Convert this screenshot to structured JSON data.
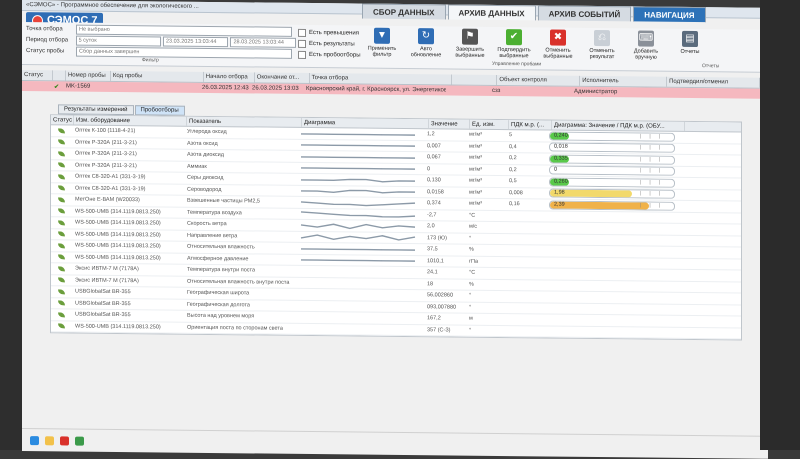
{
  "window": {
    "title": "«СЭМОС» - Программное обеспечение для экологического ..."
  },
  "app": {
    "name": "СЭМОС 7"
  },
  "tabs": [
    {
      "label": "СБОР ДАННЫХ",
      "active": false
    },
    {
      "label": "АРХИВ ДАННЫХ",
      "active": true
    },
    {
      "label": "АРХИВ СОБЫТИЙ",
      "active": false
    },
    {
      "label": "НАВИГАЦИЯ",
      "active": false
    }
  ],
  "filters": {
    "rows": [
      {
        "label": "Точка отбора",
        "value": "Не выбрано"
      },
      {
        "label": "Период отбора",
        "value": "5 суток",
        "from": "23.03.2025 13:03:44",
        "to": "28.03.2025 13:03:44"
      },
      {
        "label": "Статус пробы",
        "value": "Сбор данных завершен"
      }
    ],
    "group_label": "Фильтр"
  },
  "checks": [
    {
      "label": "Есть превышения",
      "checked": false
    },
    {
      "label": "Есть результаты",
      "checked": false
    },
    {
      "label": "Есть пробоотборы",
      "checked": false
    }
  ],
  "ribbon_buttons": [
    {
      "label": "Применить фильтр",
      "icon": "filter-icon",
      "color": "#2f6db5",
      "glyph": "▼"
    },
    {
      "label": "Авто обновление",
      "icon": "refresh-icon",
      "color": "#2f6db5",
      "glyph": "↻"
    },
    {
      "label": "Завершить выбранные",
      "icon": "flag-icon",
      "color": "#555555",
      "glyph": "⚑"
    },
    {
      "label": "Подтвердить выбранные",
      "icon": "check-icon",
      "color": "#4caf32",
      "glyph": "✔"
    },
    {
      "label": "Отменить выбранные",
      "icon": "cancel-icon",
      "color": "#d9312b",
      "glyph": "✖"
    },
    {
      "label": "Отменить результат",
      "icon": "undo-result-icon",
      "color": "#c9cfd6",
      "glyph": "⎌"
    },
    {
      "label": "Добавить вручную",
      "icon": "keyboard-icon",
      "color": "#8a9099",
      "glyph": "⌨"
    },
    {
      "label": "Отчеты",
      "icon": "report-icon",
      "color": "#5a6b7d",
      "glyph": "▤"
    }
  ],
  "ribbon_groups": {
    "control": "Управление пробами",
    "reports": "Отчеты"
  },
  "main_table": {
    "columns": [
      "Статус",
      "",
      "Номер пробы",
      "Код пробы",
      "Начало отбора",
      "Окончание от...",
      "Точка отбора",
      "",
      "Объект контроля",
      "Исполнитель",
      "Подтвердил/отменил"
    ],
    "row": {
      "number": "MK-1569",
      "start": "26.03.2025 12:43",
      "end": "26.03.2025 13:03",
      "point": "Красноярский край, г. Красноярск, ул. Энергетиков в...",
      "object": "сзз",
      "executor": "Администратор"
    }
  },
  "subtabs": [
    "Результаты измерений",
    "Пробоотборы"
  ],
  "params": {
    "columns": [
      "Статус",
      "Изм. оборудование",
      "Показатель",
      "Диаграмма",
      "Значение",
      "Ед. изм.",
      "ПДК м.р. (...",
      "Диаграмма: Значение / ПДК м.р. (ОБУ..."
    ],
    "rows": [
      {
        "eq": "Оптек К-100 (1118-4-21)",
        "ind": "Углерода оксид",
        "val": "1,2",
        "unit": "мг/м³",
        "pdk": "5",
        "ratio": "0,240",
        "fill": 0.08,
        "color": "#59c94a",
        "spark": [
          4,
          4,
          4,
          4,
          4,
          4,
          4,
          4
        ]
      },
      {
        "eq": "Оптек Р-320А (211-3-21)",
        "ind": "Азота оксид",
        "val": "0,007",
        "unit": "мг/м³",
        "pdk": "0,4",
        "ratio": "0,018",
        "fill": 0,
        "color": "#59c94a",
        "spark": [
          4,
          4,
          4,
          4,
          4,
          4,
          4,
          4
        ]
      },
      {
        "eq": "Оптек Р-320А (211-3-21)",
        "ind": "Азота диоксид",
        "val": "0,067",
        "unit": "мг/м³",
        "pdk": "0,2",
        "ratio": "0,335",
        "fill": 0.12,
        "color": "#59c94a",
        "spark": [
          4,
          4,
          4,
          4,
          4,
          4,
          4,
          4
        ]
      },
      {
        "eq": "Оптек Р-320А (211-3-21)",
        "ind": "Аммиак",
        "val": "0",
        "unit": "мг/м³",
        "pdk": "0,2",
        "ratio": "0",
        "fill": 0,
        "color": "#59c94a",
        "spark": [
          4,
          4,
          4,
          4,
          4,
          4,
          4,
          4
        ]
      },
      {
        "eq": "Оптек С8-320-А1 (331-3-19)",
        "ind": "Серы диоксид",
        "val": "0,130",
        "unit": "мг/м³",
        "pdk": "0,5",
        "ratio": "0,260",
        "fill": 0.08,
        "color": "#59c94a",
        "spark": [
          4,
          4,
          4,
          5,
          5,
          3,
          4,
          4
        ]
      },
      {
        "eq": "Оптек С8-320-А1 (331-3-19)",
        "ind": "Сероводород",
        "val": "0,0158",
        "unit": "мг/м³",
        "pdk": "0,008",
        "ratio": "1,98",
        "fill": 0.66,
        "color": "#f2d96b",
        "spark": [
          4,
          4,
          3,
          5,
          5,
          3,
          4,
          4
        ]
      },
      {
        "eq": "МетОне Е-ВАМ (W20033)",
        "ind": "Взвешенные частицы PM2,5",
        "val": "0,374",
        "unit": "мг/м³",
        "pdk": "0,16",
        "ratio": "2,39",
        "fill": 0.8,
        "color": "#f0b24a",
        "spark": [
          5,
          4,
          3,
          3,
          2,
          3,
          4,
          5
        ]
      },
      {
        "eq": "WS-500-UMB (314.1119.0813.250)",
        "ind": "Температура воздуха",
        "val": "-2,7",
        "unit": "°С",
        "pdk": "",
        "ratio": "",
        "fill": 0,
        "color": "",
        "spark": [
          6,
          5,
          4,
          3,
          3,
          2,
          2,
          3
        ]
      },
      {
        "eq": "WS-500-UMB (314.1119.0813.250)",
        "ind": "Скорость ветра",
        "val": "2,0",
        "unit": "м/с",
        "pdk": "",
        "ratio": "",
        "fill": 0,
        "color": "",
        "spark": [
          5,
          3,
          6,
          2,
          6,
          3,
          5,
          4
        ]
      },
      {
        "eq": "WS-500-UMB (314.1119.0813.250)",
        "ind": "Направление ветра",
        "val": "173 (Ю)",
        "unit": "°",
        "pdk": "",
        "ratio": "",
        "fill": 0,
        "color": "",
        "spark": [
          3,
          6,
          2,
          5,
          3,
          6,
          2,
          5
        ]
      },
      {
        "eq": "WS-500-UMB (314.1119.0813.250)",
        "ind": "Относительная влажность",
        "val": "37,5",
        "unit": "%",
        "pdk": "",
        "ratio": "",
        "fill": 0,
        "color": "",
        "spark": [
          4,
          4,
          4,
          4,
          4,
          4,
          4,
          4
        ]
      },
      {
        "eq": "WS-500-UMB (314.1119.0813.250)",
        "ind": "Атмосферное давление",
        "val": "1010,1",
        "unit": "гПа",
        "pdk": "",
        "ratio": "",
        "fill": 0,
        "color": "",
        "spark": [
          4,
          4,
          4,
          4,
          4,
          4,
          4,
          4
        ]
      },
      {
        "eq": "Эксис ИВТМ-7 М (7178А)",
        "ind": "Температура внутри поста",
        "val": "24,1",
        "unit": "°С",
        "pdk": "",
        "ratio": "",
        "fill": 0,
        "color": "",
        "spark": []
      },
      {
        "eq": "Эксис ИВТМ-7 М (7178А)",
        "ind": "Относительная влажность внутри поста",
        "val": "18",
        "unit": "%",
        "pdk": "",
        "ratio": "",
        "fill": 0,
        "color": "",
        "spark": []
      },
      {
        "eq": "USBGlobalSat BR-355",
        "ind": "Географическая широта",
        "val": "56,002860",
        "unit": "°",
        "pdk": "",
        "ratio": "",
        "fill": 0,
        "color": "",
        "spark": []
      },
      {
        "eq": "USBGlobalSat BR-355",
        "ind": "Географическая долгота",
        "val": "093,007880",
        "unit": "°",
        "pdk": "",
        "ratio": "",
        "fill": 0,
        "color": "",
        "spark": []
      },
      {
        "eq": "USBGlobalSat BR-355",
        "ind": "Высота над уровнем моря",
        "val": "167,2",
        "unit": "м",
        "pdk": "",
        "ratio": "",
        "fill": 0,
        "color": "",
        "spark": []
      },
      {
        "eq": "WS-500-UMB (314.1119.0813.250)",
        "ind": "Ориентация поста по сторонам света",
        "val": "357 (С-З)",
        "unit": "°",
        "pdk": "",
        "ratio": "",
        "fill": 0,
        "color": "",
        "spark": []
      }
    ]
  },
  "colors": {
    "accent": "#2f6db5",
    "selected_row": "#f5b8bf",
    "ok": "#59c94a",
    "warn": "#f0b24a"
  }
}
